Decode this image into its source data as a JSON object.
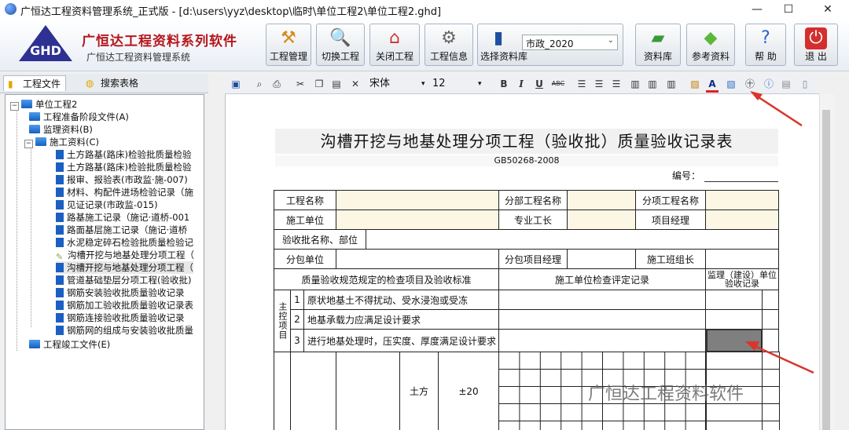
{
  "window": {
    "title": "广恒达工程资料管理系统_正式版 - [d:\\users\\yyz\\desktop\\临时\\单位工程2\\单位工程2.ghd]",
    "minimize": "—",
    "maximize": "☐",
    "close": "✕"
  },
  "brand": {
    "logo_text": "GHD",
    "name": "广恒达工程资料系列软件",
    "subtitle": "广恒达工程资料管理系统"
  },
  "toolbar": {
    "buttons": [
      {
        "label": "工程管理",
        "icon": "tools-icon"
      },
      {
        "label": "切换工程",
        "icon": "magnifier-icon"
      },
      {
        "label": "关闭工程",
        "icon": "house-icon"
      },
      {
        "label": "工程信息",
        "icon": "gear-icon"
      },
      {
        "label": "选择资料库",
        "icon": "books-icon"
      },
      {
        "label": "资料库",
        "icon": "folder-icon"
      },
      {
        "label": "参考资料",
        "icon": "diamond-icon"
      },
      {
        "label": "帮 助",
        "icon": "help-icon"
      },
      {
        "label": "退 出",
        "icon": "power-icon"
      }
    ],
    "library_select": "市政_2020"
  },
  "left_tabs": {
    "project_files": "工程文件",
    "search_forms": "搜索表格"
  },
  "tree": {
    "root": "单位工程2",
    "items": [
      "工程准备阶段文件(A)",
      "监理资料(B)",
      "施工资料(C)",
      "土方路基(路床)检验批质量检验",
      "土方路基(路床)检验批质量检验",
      "报审、报验表(市政监·施-007)",
      "材料、构配件进场检验记录（施",
      "见证记录(市政监-015)",
      "路基施工记录（施记·道桥-001",
      "路面基层施工记录（施记·道桥",
      "水泥稳定碎石检验批质量检验记",
      "沟槽开挖与地基处理分项工程（",
      "沟槽开挖与地基处理分项工程（",
      "管道基础垫层分项工程(验收批)",
      "钢筋安装验收批质量验收记录",
      "钢筋加工验收批质量验收记录表",
      "钢筋连接验收批质量验收记录",
      "钢筋网的组成与安装验收批质量",
      "工程竣工文件(E)"
    ]
  },
  "editor": {
    "font_name": "宋体",
    "font_size": "12",
    "fmt_bold": "B",
    "fmt_italic": "I",
    "fmt_underline": "U",
    "fmt_strike": "ABC",
    "text_color_glyph": "A"
  },
  "document": {
    "title": "沟槽开挖与地基处理分项工程（验收批）质量验收记录表",
    "standard": "GB50268-2008",
    "number_label": "编号：",
    "labels": {
      "project_name": "工程名称",
      "sub_project_name": "分部工程名称",
      "item_project_name": "分项工程名称",
      "construction_unit": "施工单位",
      "professional_foreman": "专业工长",
      "project_manager": "项目经理",
      "batch_name": "验收批名称、部位",
      "subcontract_unit": "分包单位",
      "subcontract_manager": "分包项目经理",
      "team_leader": "施工班组长",
      "inspection_items": "质量验收规范规定的检查项目及验收标准",
      "construction_eval": "施工单位检查评定记录",
      "supervision_record": "监理（建设）单位验收记录",
      "main_control": "主控项目",
      "earthwork": "土方",
      "tolerance": "±20"
    },
    "rows": [
      {
        "no": "1",
        "text": "原状地基土不得扰动、受水浸泡或受冻"
      },
      {
        "no": "2",
        "text": "地基承载力应满足设计要求"
      },
      {
        "no": "3",
        "text": "进行地基处理时，压实度、厚度满足设计要求"
      }
    ]
  },
  "watermark": "广恒达工程资料软件",
  "colors": {
    "brand_red": "#b4161c",
    "highlight_cell": "#7f7f7f",
    "value_cell": "#fbf7e4",
    "arrow_red": "#d9352c"
  }
}
